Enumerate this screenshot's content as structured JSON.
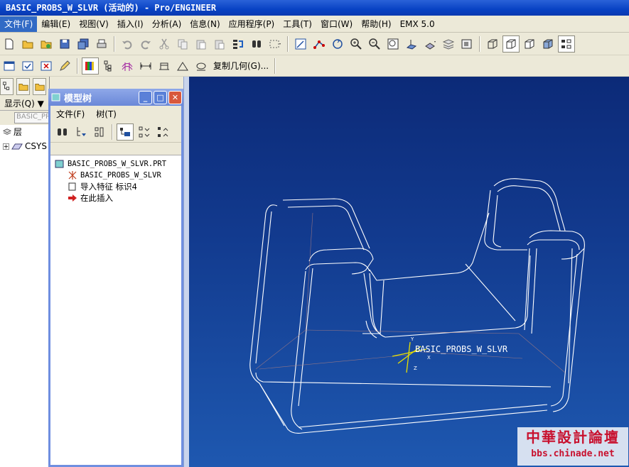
{
  "window": {
    "title": "BASIC_PROBS_W_SLVR (活动的) - Pro/ENGINEER"
  },
  "menubar": {
    "items": [
      "文件(F)",
      "编辑(E)",
      "视图(V)",
      "插入(I)",
      "分析(A)",
      "信息(N)",
      "应用程序(P)",
      "工具(T)",
      "窗口(W)",
      "帮助(H)",
      "EMX 5.0"
    ]
  },
  "toolbar2": {
    "copy_geometry_label": "复制几何(G)..."
  },
  "left_panel": {
    "display_label": "显示(Q) ▼",
    "search_placeholder": "BASIC_PR",
    "layer_label": "层",
    "csys_label": "CSYS"
  },
  "model_tree": {
    "title": "模型树",
    "menu": [
      "文件(F)",
      "树(T)"
    ],
    "items": [
      {
        "label": "BASIC_PROBS_W_SLVR.PRT",
        "icon": "part-icon"
      },
      {
        "label": "BASIC_PROBS_W_SLVR",
        "icon": "csys-icon"
      },
      {
        "label": "导入特征 标识4",
        "icon": "import-feature-icon"
      },
      {
        "label": "在此插入",
        "icon": "insert-here-arrow-icon"
      }
    ]
  },
  "viewport": {
    "csys_label": "BASIC_PROBS_W_SLVR",
    "axis_x": "X",
    "axis_y": "Y",
    "axis_z": "Z",
    "model_color": "#ffffff",
    "background_top": "#0c2a78",
    "background_bottom": "#1e58b0"
  },
  "watermark": {
    "title": "中華設計論壇",
    "url": "bbs.chinade.net"
  }
}
